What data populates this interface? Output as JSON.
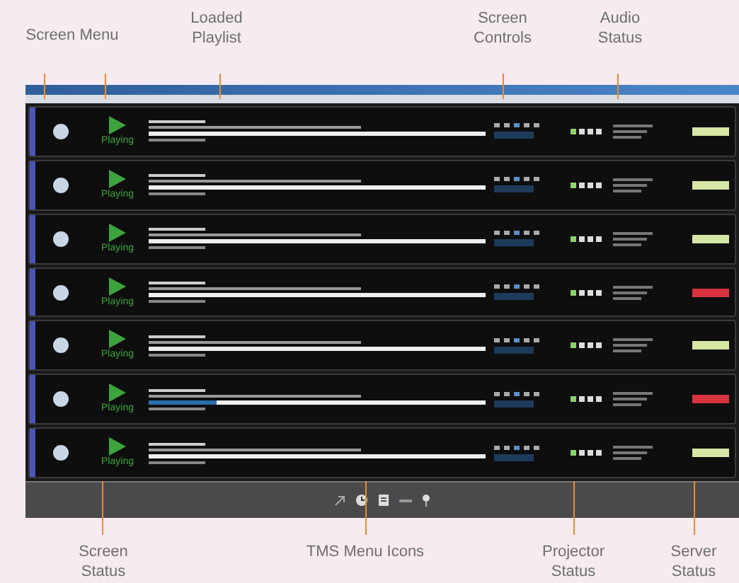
{
  "callouts_top": [
    {
      "label": "Screen Menu"
    },
    {
      "label": "Loaded Playlist"
    },
    {
      "label": "Screen Controls"
    },
    {
      "label": "Audio Status"
    }
  ],
  "screens": [
    {
      "status": "Playing",
      "level": 0,
      "color": "#d6e6a4"
    },
    {
      "status": "Playing",
      "level": 0,
      "color": "#d6e6a4"
    },
    {
      "status": "Playing",
      "level": 0,
      "color": "#d6e6a4"
    },
    {
      "status": "Playing",
      "level": 0,
      "color": "#d8323e"
    },
    {
      "status": "Playing",
      "level": 0,
      "color": "#d6e6a4"
    },
    {
      "status": "Playing",
      "level": 0.2,
      "color": "#d8323e"
    },
    {
      "status": "Playing",
      "level": 0,
      "color": "#d6e6a4"
    }
  ],
  "callouts_bottom": [
    {
      "label": "Screen Status"
    },
    {
      "label": "TMS Menu Icons"
    },
    {
      "label": "Projector Status"
    },
    {
      "label": "Server Status"
    }
  ]
}
